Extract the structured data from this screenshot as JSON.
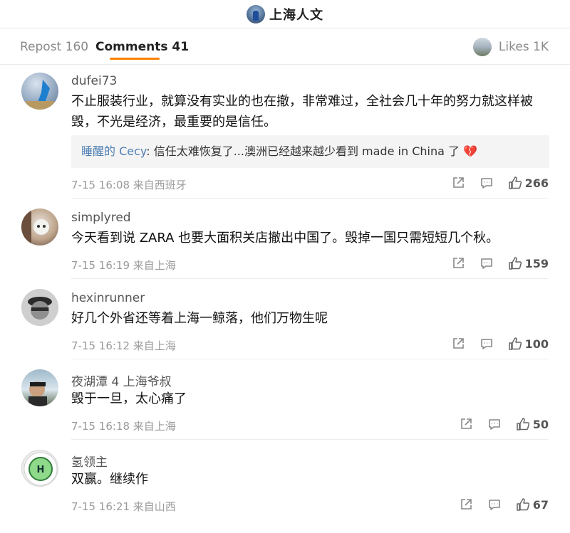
{
  "header": {
    "title": "上海人文"
  },
  "tabs": {
    "repost": "Repost 160",
    "comments": "Comments 41",
    "likes": "Likes 1K"
  },
  "comments": [
    {
      "name": "dufei73",
      "text": "不止服装行业，就算没有实业的也在撤，非常难过，全社会几十年的努力就这样被毁，不光是经济，最重要的是信任。",
      "reply": {
        "name": "睡醒的 Cecy",
        "text": ": 信任太难恢复了...澳洲已经越来越少看到 made in China 了",
        "emoji": "💔"
      },
      "meta": "7-15 16:08 来自西班牙",
      "likes": "266"
    },
    {
      "name": "simplyred",
      "text": "今天看到说 ZARA 也要大面积关店撤出中国了。毁掉一国只需短短几个秋。",
      "meta": "7-15 16:19 来自上海",
      "likes": "159"
    },
    {
      "name": "hexinrunner",
      "text": "好几个外省还等着上海一鲸落，他们万物生呢",
      "meta": "7-15 16:12 来自上海",
      "likes": "100"
    },
    {
      "name": "夜湖潭 4 上海爷叔",
      "text": "毁于一旦，太心痛了",
      "meta": "7-15 16:18 来自上海",
      "likes": "50"
    },
    {
      "name": "氢领主",
      "avatar_letter": "H",
      "text": "双赢。继续作",
      "meta": "7-15 16:21 来自山西",
      "likes": "67"
    }
  ]
}
